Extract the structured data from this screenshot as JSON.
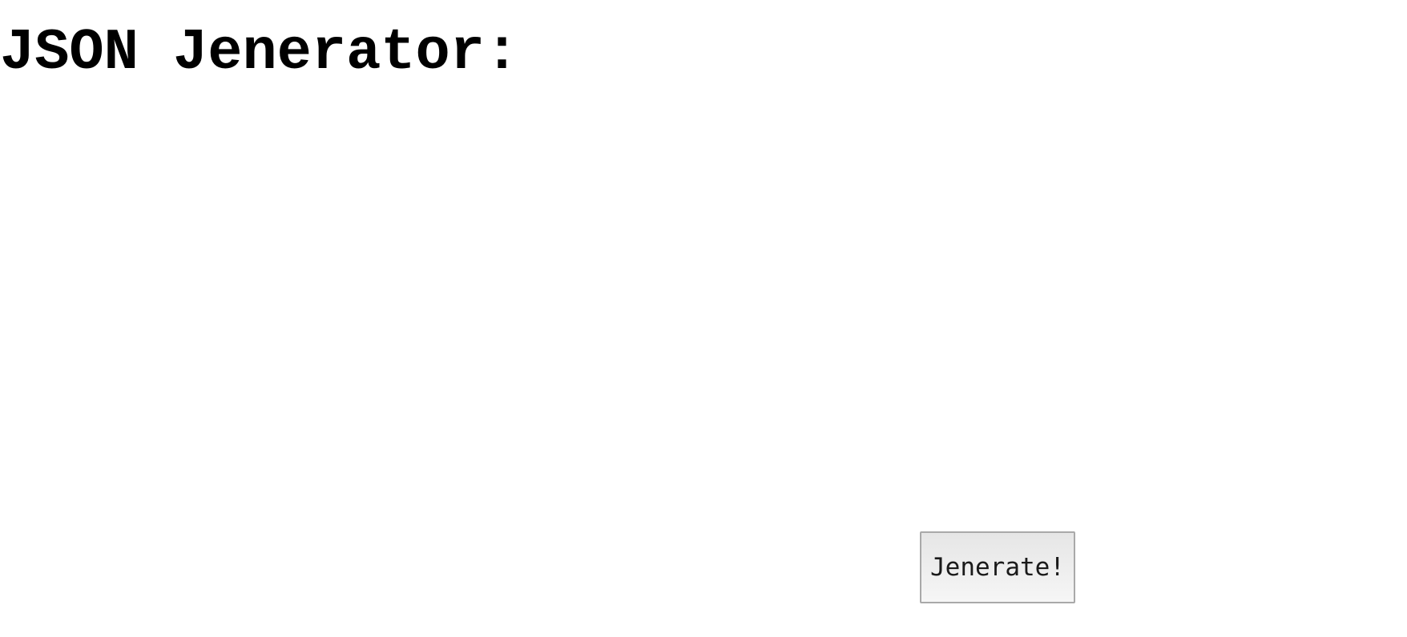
{
  "page": {
    "title": "JSON Jenerator:"
  },
  "actions": {
    "generate_label": "Jenerate!"
  }
}
